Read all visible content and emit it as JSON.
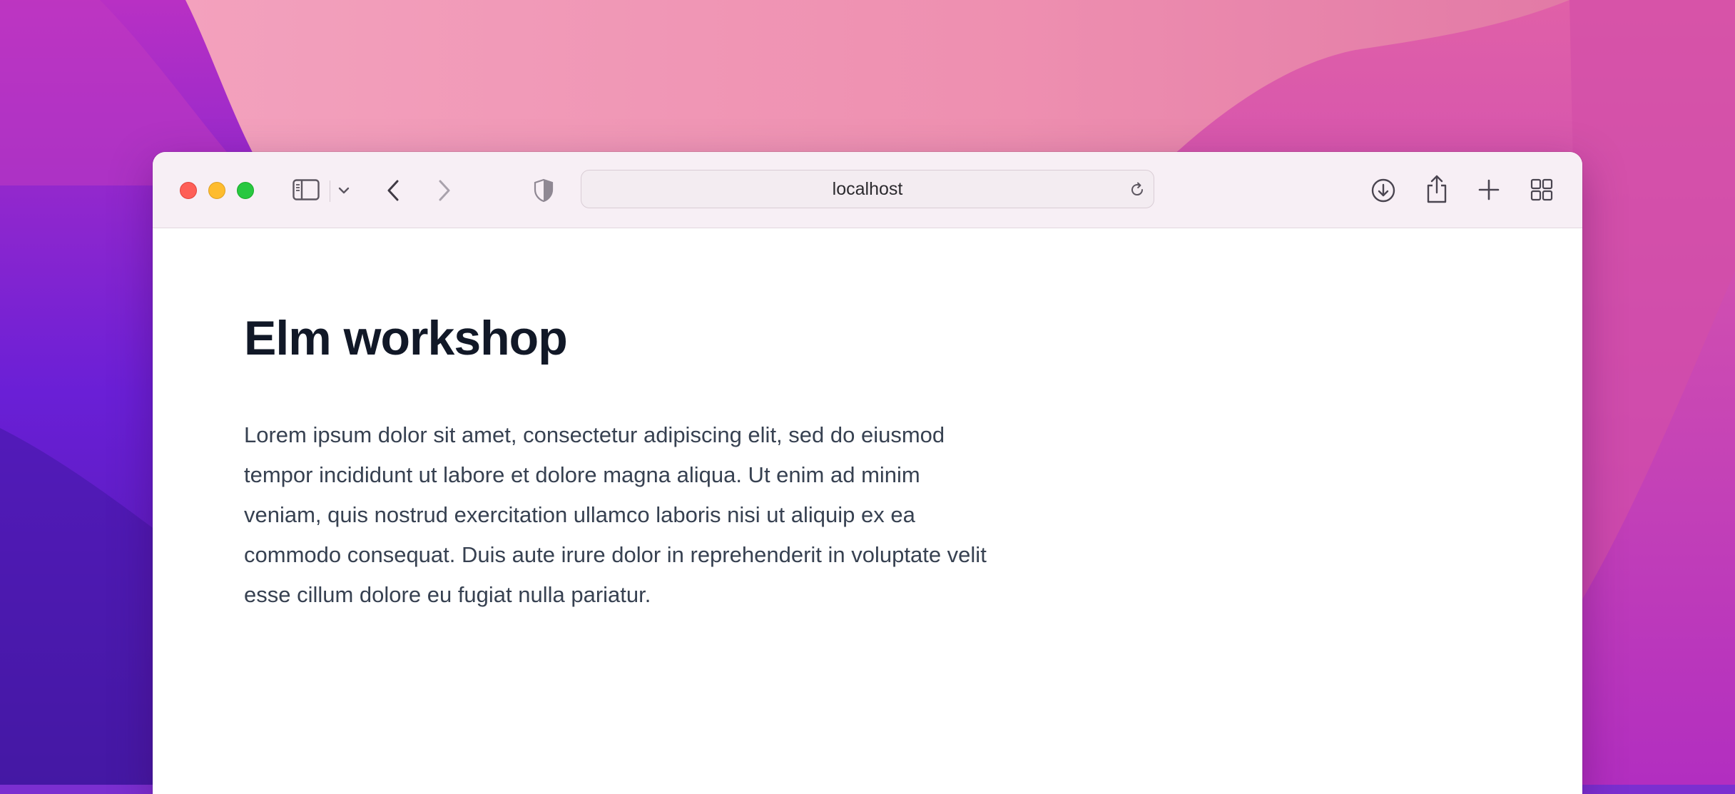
{
  "browser": {
    "address_text": "localhost",
    "traffic_lights": {
      "close": "#fe5f57",
      "minimize": "#febc2e",
      "maximize": "#28c840"
    },
    "toolbar_icons": [
      "sidebar-icon",
      "chevron-down-icon",
      "back-icon",
      "forward-icon",
      "shield-icon",
      "reload-icon",
      "download-icon",
      "share-icon",
      "plus-icon",
      "tabs-grid-icon"
    ]
  },
  "page": {
    "title": "Elm workshop",
    "paragraph": "Lorem ipsum dolor sit amet, consectetur adipiscing elit, sed do eiusmod tempor incididunt ut labore et dolore magna aliqua. Ut enim ad minim veniam, quis nostrud exercitation ullamco laboris nisi ut aliquip ex ea commodo consequat. Duis aute irure dolor in reprehenderit in voluptate velit esse cillum dolore eu fugiat nulla pariatur."
  },
  "colors": {
    "title": "#111827",
    "text": "#374151",
    "toolbar_bg": "#f7eff5",
    "wallpaper_pink": "#ee93b1",
    "wallpaper_purple": "#6a1fd0"
  }
}
